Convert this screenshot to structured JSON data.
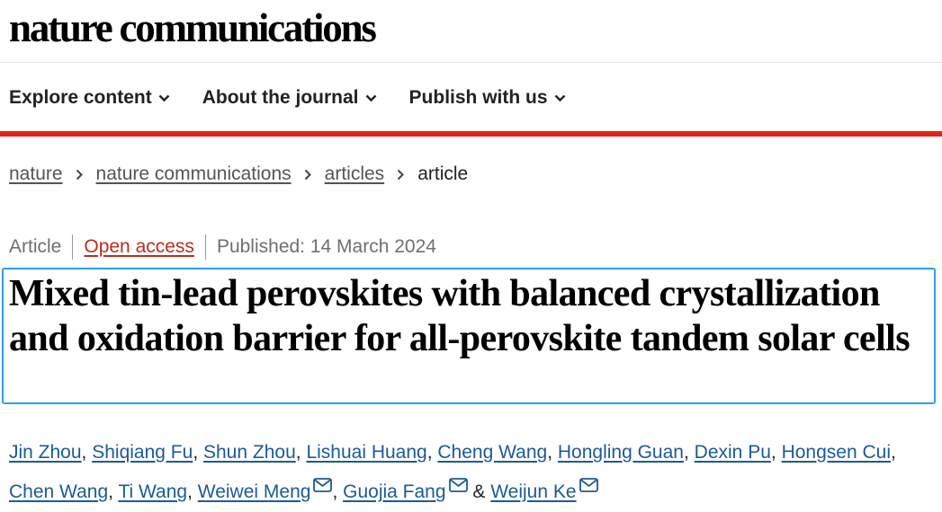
{
  "header": {
    "site_title": "nature communications"
  },
  "nav": {
    "items": [
      {
        "label": "Explore content"
      },
      {
        "label": "About the journal"
      },
      {
        "label": "Publish with us"
      }
    ]
  },
  "breadcrumb": {
    "items": [
      "nature",
      "nature communications",
      "articles"
    ],
    "current": "article"
  },
  "meta": {
    "type": "Article",
    "access": "Open access",
    "published": "Published: 14 March 2024"
  },
  "article": {
    "title": "Mixed tin-lead perovskites with balanced crystallization and oxidation barrier for all-perovskite tandem solar cells"
  },
  "authors": {
    "list": [
      "Jin Zhou",
      "Shiqiang Fu",
      "Shun Zhou",
      "Lishuai Huang",
      "Cheng Wang",
      "Hongling Guan",
      "Dexin Pu",
      "Hongsen Cui",
      "Chen Wang",
      "Ti Wang",
      "Weiwei Meng",
      "Guojia Fang",
      "Weijun Ke"
    ],
    "comma": ",",
    "ampersand": "&"
  },
  "colors": {
    "accent_red": "#e0231c",
    "link_blue": "#1c5a98",
    "open_access": "#b4301d",
    "highlight_border": "#2f9ded"
  },
  "icons": {
    "nav_chevron": "chevron-down-icon",
    "breadcrumb_separator": "chevron-right-icon",
    "corresponding_author": "envelope-icon"
  }
}
